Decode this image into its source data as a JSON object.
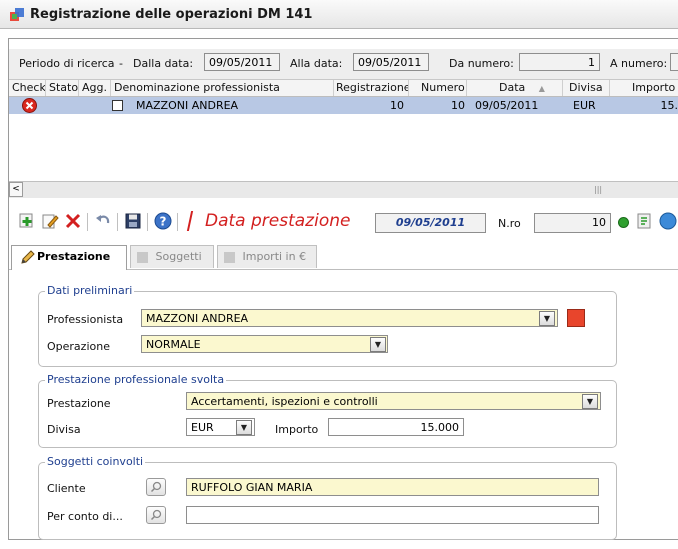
{
  "window": {
    "title": "Registrazione delle operazioni DM 141"
  },
  "search": {
    "periodo_label": "Periodo di ricerca",
    "dash": "-",
    "dalla_data_label": "Dalla data:",
    "dalla_data_value": "09/05/2011",
    "alla_data_label": "Alla data:",
    "alla_data_value": "09/05/2011",
    "da_numero_label": "Da numero:",
    "da_numero_value": "1",
    "a_numero_label": "A numero:"
  },
  "grid": {
    "columns": [
      "Check",
      "Stato",
      "Agg.",
      "Denominazione professionista",
      "Registrazione",
      "Numero",
      "Data",
      "Divisa",
      "Importo"
    ],
    "sort_indicator": "▲",
    "rows": [
      {
        "check": "error",
        "stato": "",
        "agg": "",
        "denominazione": "MAZZONI ANDREA",
        "registrazione": "10",
        "numero": "10",
        "data": "09/05/2011",
        "divisa": "EUR",
        "importo": "15."
      }
    ],
    "scroll_left": "<",
    "scroll_grip": "|||"
  },
  "toolbar": {
    "title": "Data prestazione",
    "date_value": "09/05/2011",
    "nro_label": "N.ro",
    "nro_value": "10",
    "icons": [
      "add-icon",
      "edit-icon",
      "delete-icon",
      "undo-icon",
      "save-icon",
      "help-icon"
    ],
    "status_color": "#2fa02f"
  },
  "tabs": [
    {
      "label": "Prestazione",
      "active": true
    },
    {
      "label": "Soggetti",
      "active": false
    },
    {
      "label": "Importi in €",
      "active": false
    }
  ],
  "dati_preliminari": {
    "legend": "Dati preliminari",
    "professionista_label": "Professionista",
    "professionista_value": "MAZZONI ANDREA",
    "operazione_label": "Operazione",
    "operazione_value": "NORMALE",
    "color_swatch": "#e8452c"
  },
  "prestazione": {
    "legend": "Prestazione professionale svolta",
    "prestazione_label": "Prestazione",
    "prestazione_value": "Accertamenti, ispezioni e controlli",
    "divisa_label": "Divisa",
    "divisa_value": "EUR",
    "importo_label": "Importo",
    "importo_value": "15.000"
  },
  "soggetti": {
    "legend": "Soggetti coinvolti",
    "cliente_label": "Cliente",
    "cliente_value": "RUFFOLO GIAN MARIA",
    "per_conto_label": "Per conto di...",
    "per_conto_value": ""
  },
  "colors": {
    "accent_red": "#d32020",
    "selection": "#b8c8e4",
    "field_yellow": "#fbf8cf"
  }
}
